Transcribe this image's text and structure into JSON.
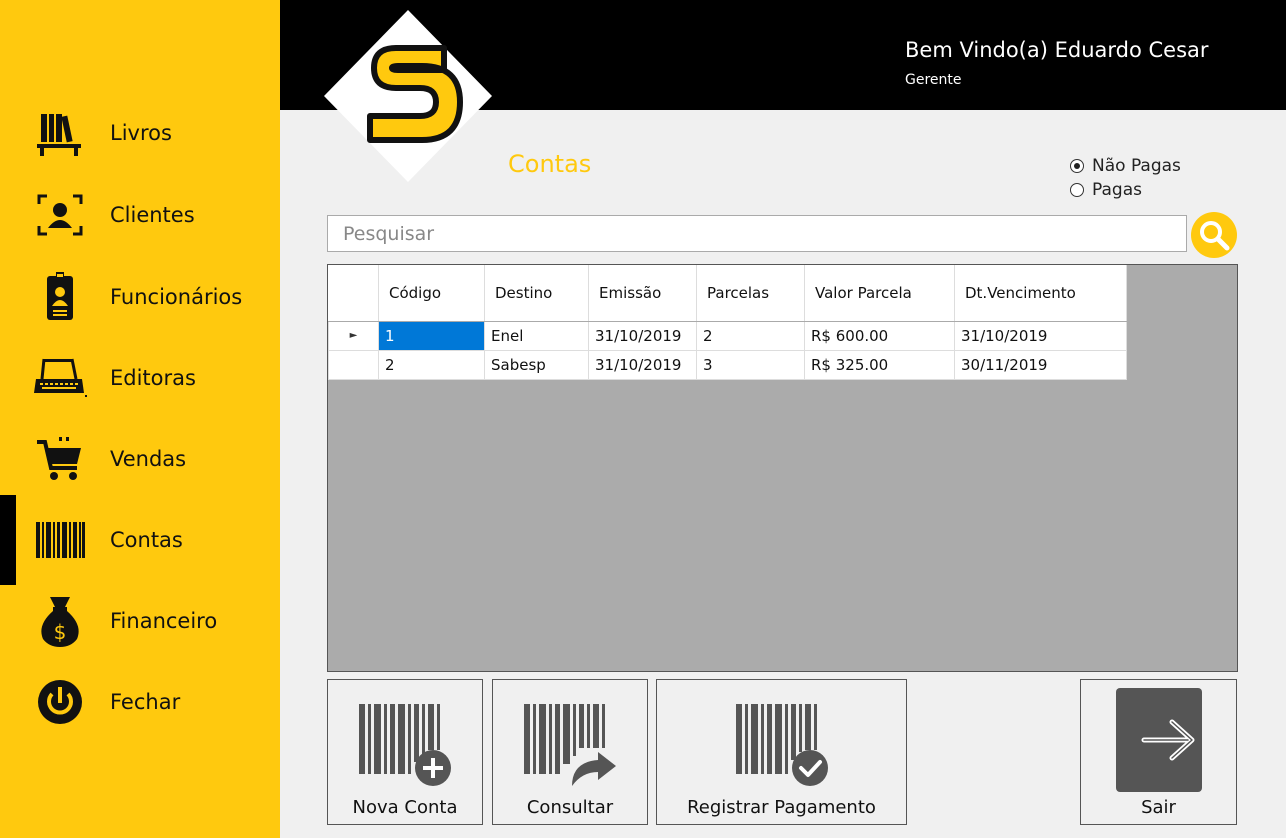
{
  "sidebar": {
    "items": [
      {
        "label": "Livros",
        "icon": "books-icon"
      },
      {
        "label": "Clientes",
        "icon": "client-icon"
      },
      {
        "label": "Funcionários",
        "icon": "employee-badge-icon"
      },
      {
        "label": "Editoras",
        "icon": "typewriter-icon"
      },
      {
        "label": "Vendas",
        "icon": "cart-icon"
      },
      {
        "label": "Contas",
        "icon": "barcode-icon",
        "active": true
      },
      {
        "label": "Financeiro",
        "icon": "money-bag-icon"
      },
      {
        "label": "Fechar",
        "icon": "power-icon"
      }
    ]
  },
  "header": {
    "welcome": "Bem Vindo(a) Eduardo Cesar",
    "role": "Gerente"
  },
  "page": {
    "title": "Contas"
  },
  "filter": {
    "options": [
      "Não Pagas",
      "Pagas"
    ],
    "selected": "Não Pagas"
  },
  "search": {
    "placeholder": "Pesquisar"
  },
  "table": {
    "columns": [
      "Código",
      "Destino",
      "Emissão",
      "Parcelas",
      "Valor Parcela",
      "Dt.Vencimento"
    ],
    "rows": [
      [
        "1",
        "Enel",
        "31/10/2019",
        "2",
        "R$ 600.00",
        "31/10/2019"
      ],
      [
        "2",
        "Sabesp",
        "31/10/2019",
        "3",
        "R$ 325.00",
        "30/11/2019"
      ]
    ]
  },
  "actions": {
    "new": "Nova Conta",
    "consult": "Consultar",
    "register": "Registrar Pagamento",
    "exit": "Sair"
  },
  "colors": {
    "accent": "#ffc90e",
    "header": "#000000",
    "selection": "#0078d7"
  }
}
